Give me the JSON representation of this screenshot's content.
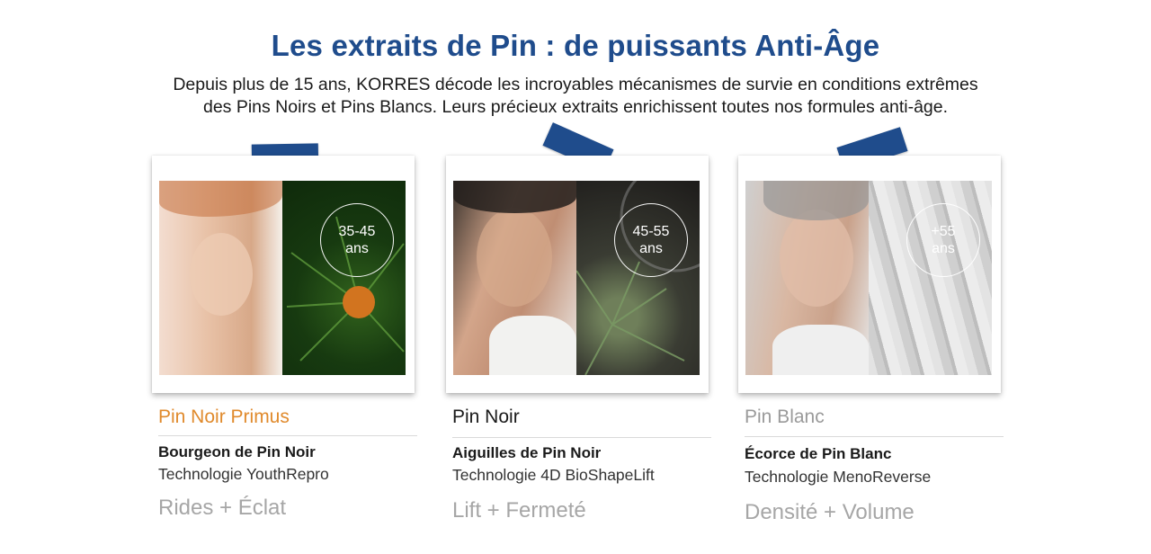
{
  "title": "Les extraits de Pin : de puissants Anti-Âge",
  "subtitle": {
    "line1": "Depuis plus de 15 ans, KORRES décode les incroyables mécanismes de survie en conditions extrêmes",
    "line2": "des Pins Noirs et Pins Blancs. Leurs précieux extraits enrichissent toutes nos formules anti-âge."
  },
  "colors": {
    "title": "#1f4c8c",
    "tape": "#1f4c8c",
    "primus_accent": "#e08a2c",
    "pin_blanc_name": "#9a9a9a",
    "benefit": "#a6a6a6"
  },
  "cards": [
    {
      "age_range": "35-45",
      "age_unit": "ans",
      "line_name": "Pin Noir Primus",
      "ingredient": "Bourgeon de Pin Noir",
      "technology": "Technologie YouthRepro",
      "benefit": "Rides + Éclat"
    },
    {
      "age_range": "45-55",
      "age_unit": "ans",
      "line_name": "Pin Noir",
      "ingredient": "Aiguilles de Pin Noir",
      "technology": "Technologie 4D BioShapeLift",
      "benefit": "Lift + Fermeté"
    },
    {
      "age_range": "+55",
      "age_unit": "ans",
      "line_name": "Pin Blanc",
      "ingredient": "Écorce de Pin Blanc",
      "technology": "Technologie MenoReverse",
      "benefit": "Densité + Volume"
    }
  ]
}
